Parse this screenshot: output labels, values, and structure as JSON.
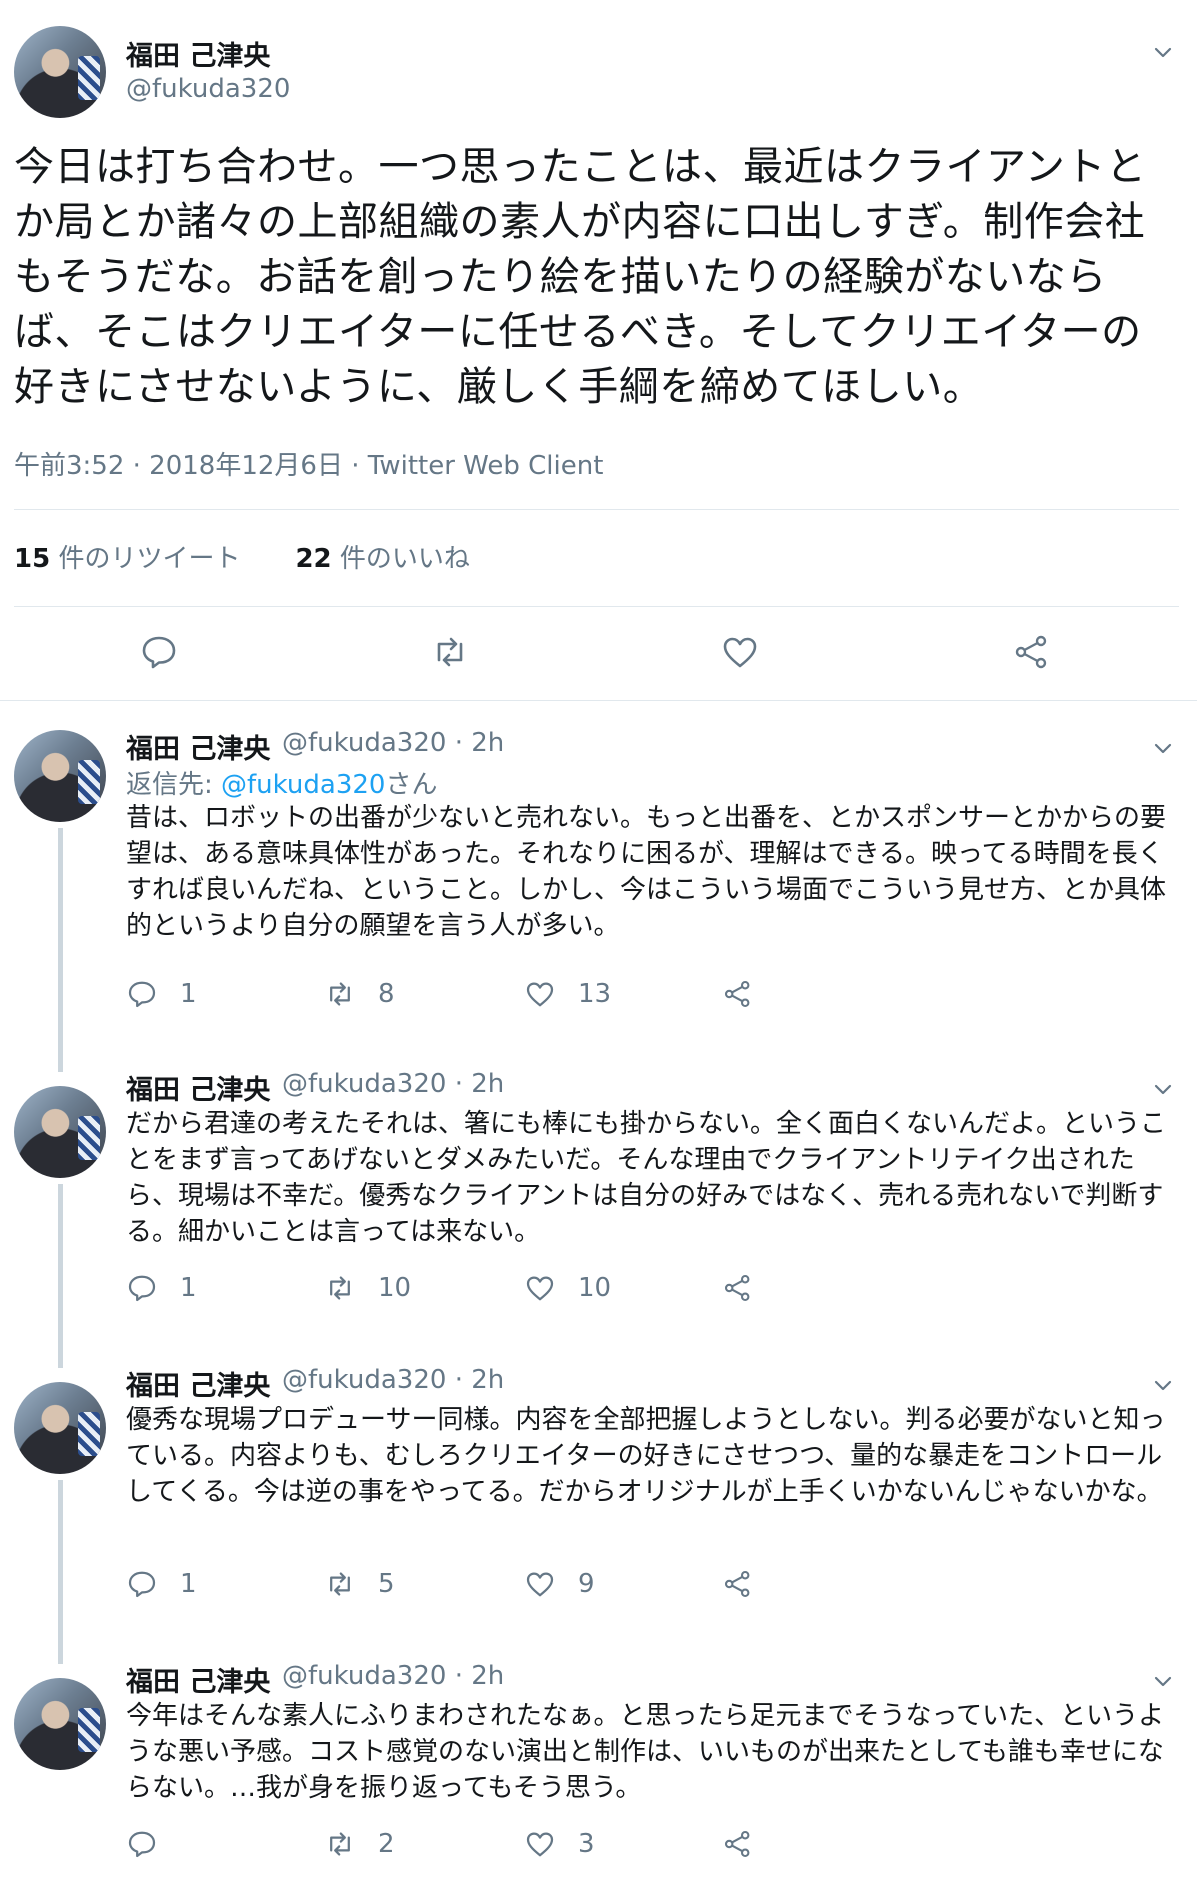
{
  "main_tweet": {
    "author_name": "福田 己津央",
    "author_handle": "@fukuda320",
    "text": "今日は打ち合わせ。一つ思ったことは、最近はクライアントとか局とか諸々の上部組織の素人が内容に口出しすぎ。制作会社もそうだな。お話を創ったり絵を描いたりの経験がないならば、そこはクリエイターに任せるべき。そしてクリエイターの好きにさせないように、厳しく手綱を締めてほしい。",
    "timestamp": "午前3:52 · 2018年12月6日 · Twitter Web Client",
    "retweet_count": "15",
    "retweet_label": "件のリツイート",
    "like_count": "22",
    "like_label": "件のいいね"
  },
  "replies": [
    {
      "author_name": "福田 己津央",
      "author_handle": "@fukuda320",
      "time": "· 2h",
      "replying_to_prefix": "返信先: ",
      "replying_to_mention": "@fukuda320",
      "replying_to_suffix": "さん",
      "text": "昔は、ロボットの出番が少ないと売れない。もっと出番を、とかスポンサーとかからの要望は、ある意味具体性があった。それなりに困るが、理解はできる。映ってる時間を長くすれば良いんだね、ということ。しかし、今はこういう場面でこういう見せ方、とか具体的というより自分の願望を言う人が多い。",
      "replies": "1",
      "retweets": "8",
      "likes": "13"
    },
    {
      "author_name": "福田 己津央",
      "author_handle": "@fukuda320",
      "time": "· 2h",
      "text": "だから君達の考えたそれは、箸にも棒にも掛からない。全く面白くないんだよ。ということをまず言ってあげないとダメみたいだ。そんな理由でクライアントリテイク出されたら、現場は不幸だ。優秀なクライアントは自分の好みではなく、売れる売れないで判断する。細かいことは言っては来ない。",
      "replies": "1",
      "retweets": "10",
      "likes": "10"
    },
    {
      "author_name": "福田 己津央",
      "author_handle": "@fukuda320",
      "time": "· 2h",
      "text": "優秀な現場プロデューサー同様。内容を全部把握しようとしない。判る必要がないと知っている。内容よりも、むしろクリエイターの好きにさせつつ、量的な暴走をコントロールしてくる。今は逆の事をやってる。だからオリジナルが上手くいかないんじゃないかな。",
      "replies": "1",
      "retweets": "5",
      "likes": "9"
    },
    {
      "author_name": "福田 己津央",
      "author_handle": "@fukuda320",
      "time": "· 2h",
      "text": "今年はそんな素人にふりまわされたなぁ。と思ったら足元までそうなっていた、というような悪い予感。コスト感覚のない演出と制作は、いいものが出来たとしても誰も幸せにならない。…我が身を振り返ってもそう思う。",
      "replies": "",
      "retweets": "2",
      "likes": "3"
    }
  ],
  "icons": {
    "reply": "speech-bubble-icon",
    "retweet": "retweet-arrows-icon",
    "like": "heart-icon",
    "share": "share-nodes-icon",
    "menu": "chevron-down-icon"
  },
  "colors": {
    "link": "#1da1f2",
    "muted": "#657786",
    "text": "#14171a",
    "divider": "#e1e8ed"
  }
}
